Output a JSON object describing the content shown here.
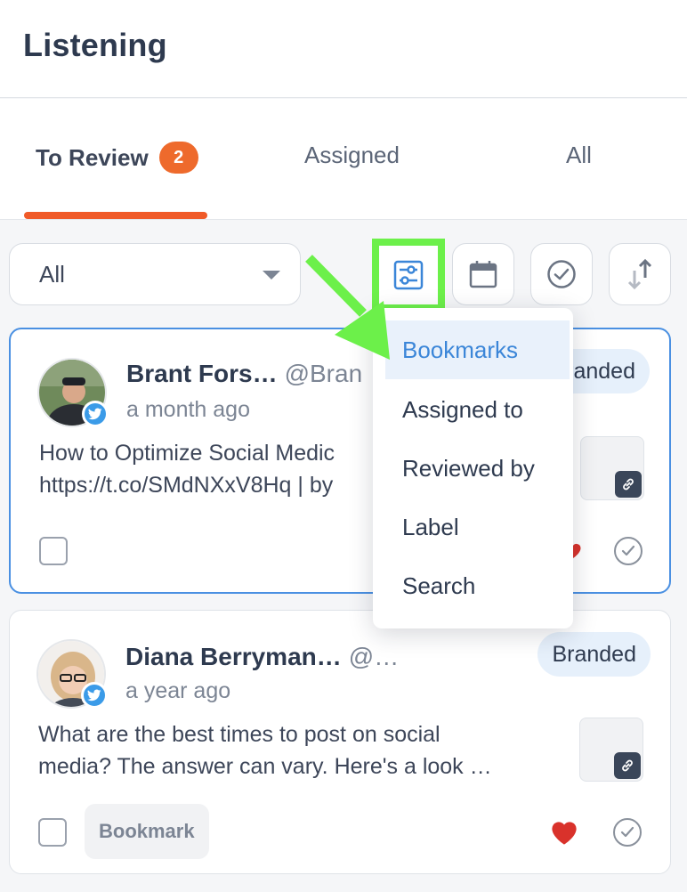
{
  "header": {
    "title": "Listening"
  },
  "tabs": [
    {
      "label": "To Review",
      "badge": "2",
      "active": true
    },
    {
      "label": "Assigned",
      "active": false
    },
    {
      "label": "All",
      "active": false
    }
  ],
  "filter": {
    "selected": "All"
  },
  "toolbar": {
    "buttons": [
      {
        "icon": "sliders-icon",
        "highlighted": true
      },
      {
        "icon": "calendar-icon"
      },
      {
        "icon": "check-circle-icon"
      },
      {
        "icon": "sort-icon"
      }
    ]
  },
  "dropdown": {
    "items": [
      {
        "label": "Bookmarks",
        "highlighted": true
      },
      {
        "label": "Assigned to"
      },
      {
        "label": "Reviewed by"
      },
      {
        "label": "Label"
      },
      {
        "label": "Search"
      }
    ]
  },
  "posts": [
    {
      "author": "Brant Fors…",
      "handle": "@Bran",
      "time": "a month ago",
      "text_line1": "How to Optimize Social Medic",
      "text_line2": "https://t.co/SMdNXxV8Hq | by",
      "label": "Branded",
      "network": "twitter-icon",
      "liked": true
    },
    {
      "author": "Diana Berryman…",
      "handle": "@…",
      "time": "a year ago",
      "text_line1": "What are the best times to post on social",
      "text_line2": "media? The answer can vary. Here's a look …",
      "label": "Branded",
      "bookmark_label": "Bookmark",
      "network": "twitter-icon",
      "liked": true
    }
  ],
  "colors": {
    "accent_orange": "#f05a28",
    "selected_blue": "#4a90e2",
    "highlight_green": "#6cf04a",
    "heart_red": "#d9322b",
    "twitter_blue": "#3b9be8"
  }
}
